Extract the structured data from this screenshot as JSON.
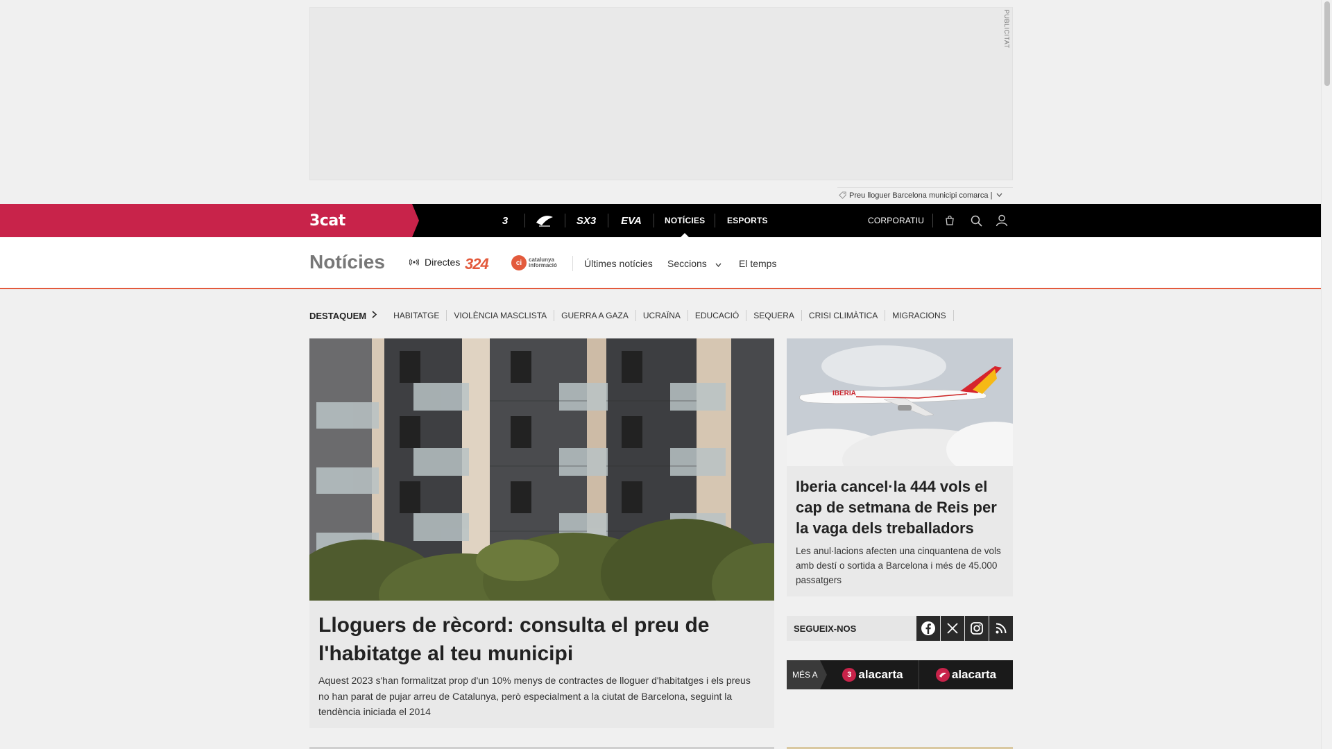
{
  "ad": {
    "label": "PUBLICITAT",
    "search_text": "Preu lloguer Barcelona municipi comarca |"
  },
  "topnav": {
    "brand": "3cat",
    "channels": [
      "3",
      "Cat Ràdio",
      "SX3",
      "EVA"
    ],
    "noticies": "NOTÍCIES",
    "esports": "ESPORTS",
    "corporatiu": "CORPORATIU"
  },
  "section": {
    "title": "Notícies",
    "directes": "Directes",
    "logo_324": "324",
    "catinfo": "catalunya informació",
    "nav": [
      "Últimes notícies",
      "Seccions",
      "El temps"
    ]
  },
  "destaquem": {
    "lead": "DESTAQUEM",
    "tags": [
      "HABITATGE",
      "VIOLÈNCIA MASCLISTA",
      "GUERRA A GAZA",
      "UCRAÏNA",
      "EDUCACIÓ",
      "SEQUERA",
      "CRISI CLIMÀTICA",
      "MIGRACIONS"
    ]
  },
  "main_article": {
    "title": "Lloguers de rècord: consulta el preu de l'habitatge al teu municipi",
    "summary": "Aquest 2023 s'han formalitzat prop d'un 10% menys de contractes de lloguer d'habitatges i els preus no han parat de pujar arreu de Catalunya, però especialment a la ciutat de Barcelona, seguint la tendència iniciada el 2014"
  },
  "side_article": {
    "image_text": "IBERIA",
    "title": "Iberia cancel·la 444 vols el cap de setmana de Reis per la vaga dels treballadors",
    "summary": "Les anul·lacions afecten una cinquantena de vols amb destí o sortida a Barcelona i més de 45.000 passatgers"
  },
  "follow": {
    "label": "SEGUEIX-NOS",
    "networks": [
      "facebook",
      "x",
      "instagram",
      "rss"
    ]
  },
  "mes_a": {
    "label": "MÉS A",
    "items": [
      "alacarta",
      "alacarta"
    ]
  },
  "colors": {
    "brand": "#c8234a",
    "accent": "#e35a3c",
    "nav_bg": "#000000"
  }
}
